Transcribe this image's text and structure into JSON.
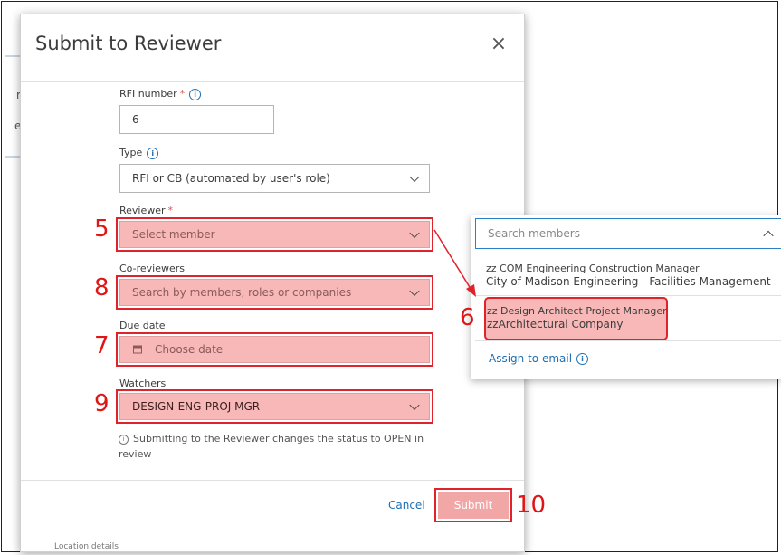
{
  "dialog": {
    "title": "Submit to Reviewer",
    "close_glyph": "×"
  },
  "fields": {
    "rfi_number": {
      "label": "RFI number",
      "required_mark": "*",
      "value": "6"
    },
    "type": {
      "label": "Type",
      "value": "RFI or CB (automated by user's role)"
    },
    "reviewer": {
      "label": "Reviewer",
      "required_mark": "*",
      "placeholder": "Select member"
    },
    "co_reviewers": {
      "label": "Co-reviewers",
      "placeholder": "Search by members, roles or companies"
    },
    "due_date": {
      "label": "Due date",
      "placeholder": "Choose date"
    },
    "watchers": {
      "label": "Watchers",
      "value": "DESIGN-ENG-PROJ MGR"
    }
  },
  "helper_text": "Submitting to the Reviewer changes the status to OPEN in review",
  "footer": {
    "cancel_label": "Cancel",
    "submit_label": "Submit"
  },
  "popup": {
    "search_placeholder": "Search members",
    "members": [
      {
        "role": "zz COM Engineering Construction Manager",
        "company": "City of Madison Engineering - Facilities Management"
      },
      {
        "role": "zz Design Architect Project Manager",
        "company": "zzArchitectural Company"
      }
    ],
    "assign_label": "Assign to email"
  },
  "steps": {
    "reviewer": "5",
    "member": "6",
    "due_date": "7",
    "co_reviewers": "8",
    "watchers": "9",
    "submit": "10"
  },
  "background": {
    "fragments": [
      "r",
      "e"
    ],
    "footer_fragment": "Location details"
  },
  "colors": {
    "highlight_fill": "#f8b8b8",
    "highlight_border": "#e0232a",
    "link": "#1f6fb2",
    "step_number": "#e01515"
  },
  "icons": [
    "close-icon",
    "info-icon",
    "chevron-down-icon",
    "chevron-up-icon",
    "calendar-icon",
    "arrow-annotation"
  ]
}
